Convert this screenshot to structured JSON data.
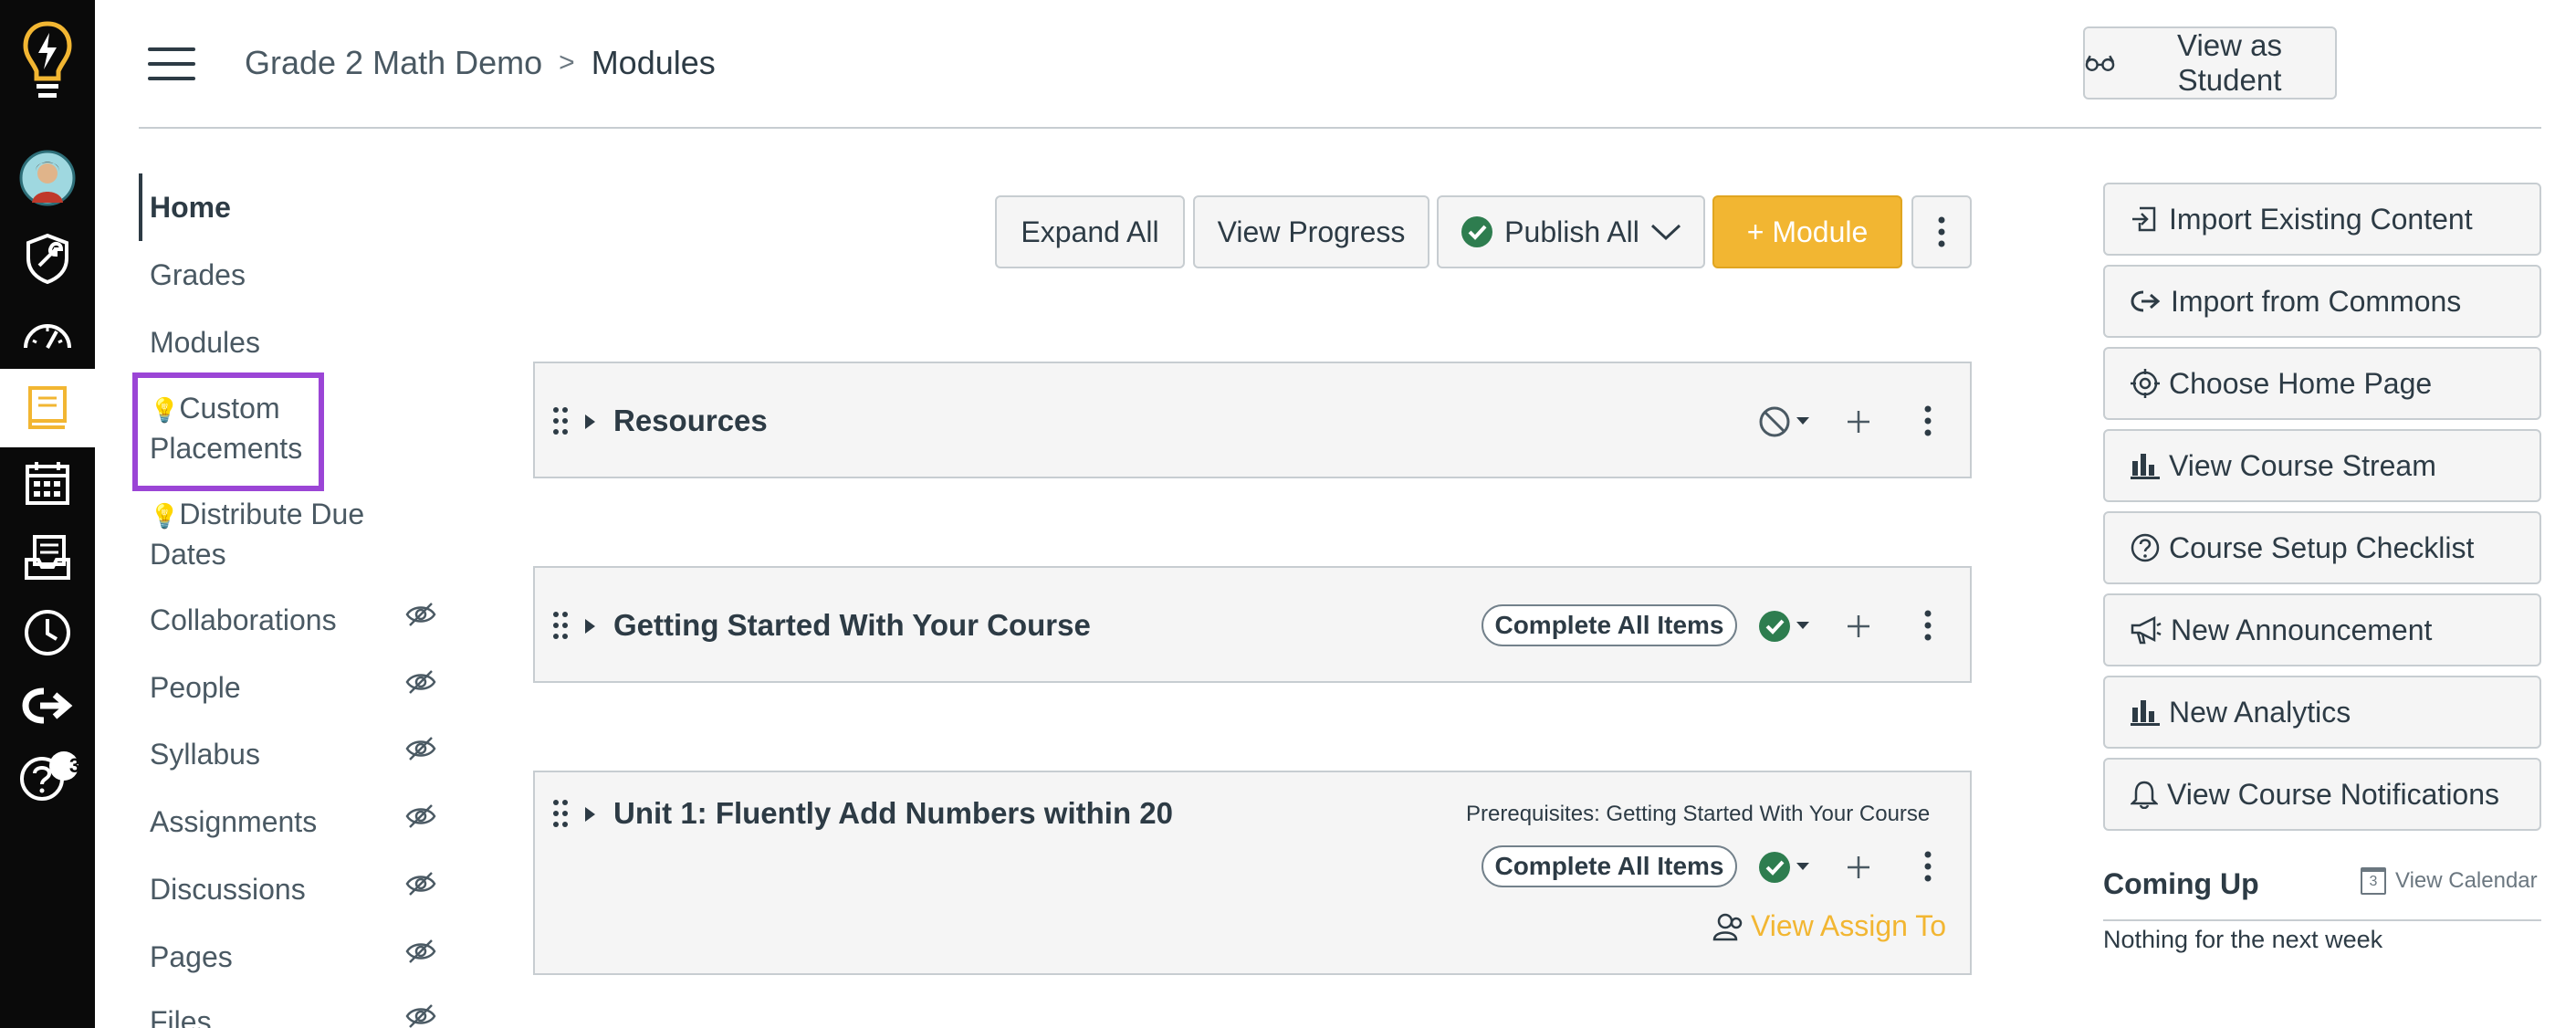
{
  "global_nav": {
    "badge_count": "3",
    "accent": "#f2b632"
  },
  "header": {
    "breadcrumb_course": "Grade 2 Math Demo",
    "breadcrumb_separator": ">",
    "breadcrumb_page": "Modules",
    "view_as_student": "View as Student"
  },
  "course_nav": {
    "items": [
      {
        "label": "Home"
      },
      {
        "label": "Grades"
      },
      {
        "label": "Modules"
      },
      {
        "label": "Custom",
        "label2": "Placements"
      },
      {
        "label": "Distribute Due",
        "label2": "Dates"
      },
      {
        "label": "Collaborations"
      },
      {
        "label": "People"
      },
      {
        "label": "Syllabus"
      },
      {
        "label": "Assignments"
      },
      {
        "label": "Discussions"
      },
      {
        "label": "Pages"
      },
      {
        "label": "Files"
      }
    ]
  },
  "toolbar": {
    "expand_all": "Expand All",
    "view_progress": "View Progress",
    "publish_all": "Publish All",
    "add_module": "+ Module"
  },
  "modules": [
    {
      "title": "Resources"
    },
    {
      "title": "Getting Started With Your Course",
      "requirement": "Complete All Items"
    },
    {
      "title": "Unit 1: Fluently Add Numbers within 20",
      "prerequisites": "Prerequisites: Getting Started With Your Course",
      "requirement": "Complete All Items",
      "assign_link": "View Assign To"
    }
  ],
  "sidebar": {
    "buttons": [
      {
        "label": "Import Existing Content",
        "icon": "import-icon"
      },
      {
        "label": "Import from Commons",
        "icon": "commons-icon"
      },
      {
        "label": "Choose Home Page",
        "icon": "target-icon"
      },
      {
        "label": "View Course Stream",
        "icon": "bar-chart-icon"
      },
      {
        "label": "Course Setup Checklist",
        "icon": "question-icon"
      },
      {
        "label": "New Announcement",
        "icon": "megaphone-icon"
      },
      {
        "label": "New Analytics",
        "icon": "bar-chart-icon"
      },
      {
        "label": "View Course Notifications",
        "icon": "bell-icon"
      }
    ],
    "coming_up": "Coming Up",
    "view_calendar": "View Calendar",
    "calendar_day": "3",
    "nothing_text": "Nothing for the next week"
  },
  "colors": {
    "published_green": "#2e7d4f",
    "highlight_purple": "#9b45d6",
    "module_button": "#f2b632"
  }
}
